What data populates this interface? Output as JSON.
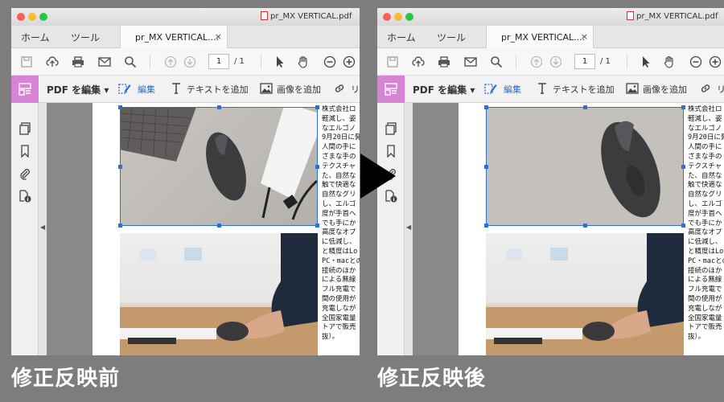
{
  "window": {
    "title": "pr_MX VERTICAL.pdf"
  },
  "tabs": {
    "home": "ホーム",
    "tools": "ツール",
    "document": "pr_MX VERTICAL....",
    "close": "×"
  },
  "toolbar": {
    "page_current": "1",
    "page_total": "/ 1"
  },
  "edit_toolbar": {
    "edit_pdf": "PDF を編集",
    "edit": "編集",
    "add_text": "テキストを追加",
    "add_image": "画像を追加",
    "link_partial": "リ"
  },
  "document_text": [
    "株式会社ロ",
    "軽減し、姿",
    "なエルゴノ",
    "9月20日に発",
    "人間の手に",
    "ざまな手の",
    "テクスチャ",
    "た、自然な",
    "触で快適な",
    "自然なグリ",
    "し、エルゴ",
    "度が手首へ",
    "でも手にか",
    "高度なオプ",
    "に低減し、",
    "と精度はLo",
    "PC・macとの",
    "接続のほか",
    "による無線",
    "フル充電で",
    "間の使用が",
    "充電しなが",
    "全国家電量",
    "トアで販売",
    "抜）。"
  ],
  "captions": {
    "before": "修正反映前",
    "after": "修正反映後"
  }
}
